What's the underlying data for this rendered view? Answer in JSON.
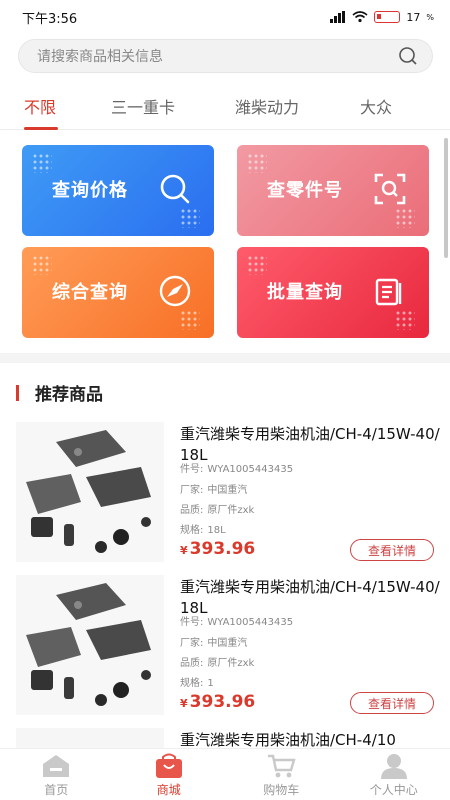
{
  "status_bar": {
    "time": "下午3:56",
    "battery": "17"
  },
  "search": {
    "placeholder": "请搜索商品相关信息"
  },
  "tabs": [
    {
      "label": "不限",
      "active": true
    },
    {
      "label": "三一重卡"
    },
    {
      "label": "潍柴动力"
    },
    {
      "label": "大众"
    }
  ],
  "tiles": [
    {
      "label": "查询价格",
      "icon": "search-icon",
      "color": "#3f8ff2"
    },
    {
      "label": "查零件号",
      "icon": "scan-icon",
      "color": "#ee7c86"
    },
    {
      "label": "综合查询",
      "icon": "compass-icon",
      "color": "#fb8239"
    },
    {
      "label": "批量查询",
      "icon": "document-icon",
      "color": "#f0394e"
    }
  ],
  "section": {
    "title": "推荐商品"
  },
  "products": [
    {
      "title": "重汽潍柴专用柴油机油/CH-4/15W-40/18L",
      "part_label": "件号:",
      "part_no": "WYA1005443435",
      "maker_label": "厂家:",
      "maker": "中国重汽",
      "quality_label": "品质:",
      "quality": "原厂件zxk",
      "spec_label": "规格:",
      "spec": "18L",
      "currency": "¥",
      "price": "393.96",
      "detail_label": "查看详情"
    },
    {
      "title": "重汽潍柴专用柴油机油/CH-4/15W-40/18L",
      "part_label": "件号:",
      "part_no": "WYA1005443435",
      "maker_label": "厂家:",
      "maker": "中国重汽",
      "quality_label": "品质:",
      "quality": "原厂件zxk",
      "spec_label": "规格:",
      "spec": "1",
      "currency": "¥",
      "price": "393.96",
      "detail_label": "查看详情"
    },
    {
      "title": "重汽潍柴专用柴油机油/CH-4/10"
    }
  ],
  "bottom_nav": [
    {
      "label": "首页",
      "icon": "home-icon"
    },
    {
      "label": "商城",
      "icon": "shopping-bag-icon",
      "active": true
    },
    {
      "label": "购物车",
      "icon": "cart-icon"
    },
    {
      "label": "个人中心",
      "icon": "user-icon"
    }
  ],
  "colors": {
    "accent": "#d93a2b"
  }
}
